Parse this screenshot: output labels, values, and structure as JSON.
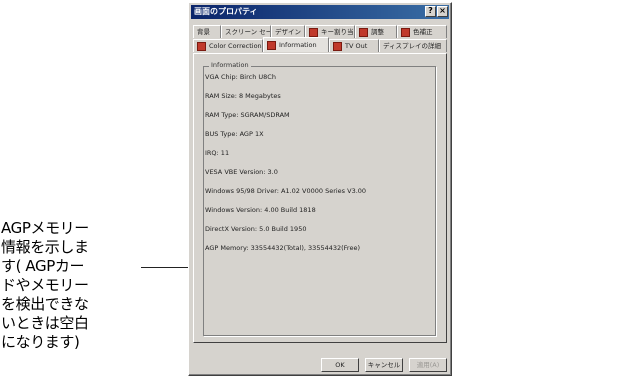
{
  "dialog": {
    "title": "画面のプロパティ",
    "tabs_row1": [
      {
        "label": "背景",
        "icon": false
      },
      {
        "label": "スクリーン セーバー",
        "icon": false
      },
      {
        "label": "デザイン",
        "icon": false
      },
      {
        "label": "キー割り当て",
        "icon": true
      },
      {
        "label": "調整",
        "icon": true
      },
      {
        "label": "色補正",
        "icon": true
      }
    ],
    "tabs_row2": [
      {
        "label": "Color Correction",
        "icon": true
      },
      {
        "label": "Information",
        "icon": true,
        "active": true
      },
      {
        "label": "TV Out",
        "icon": true
      },
      {
        "label": "ディスプレイの詳細",
        "icon": false
      }
    ],
    "group_label": "Information",
    "info": [
      "VGA Chip: Birch U8Ch",
      "RAM Size: 8 Megabytes",
      "RAM Type: SGRAM/SDRAM",
      "BUS Type: AGP 1X",
      "IRQ: 11",
      "VESA VBE Version: 3.0",
      "Windows 95/98 Driver: A1.02 V0000 Series V3.00",
      "Windows Version: 4.00 Build 1818",
      "DirectX Version: 5.0 Build 1950",
      "AGP Memory: 33554432(Total), 33554432(Free)"
    ],
    "buttons": {
      "ok": "OK",
      "cancel": "キャンセル",
      "apply": "適用(A)"
    }
  },
  "callout": {
    "lines": [
      "AGPメモリー",
      "情報を示しま",
      "す( AGPカー",
      "ドやメモリー",
      "を検出できな",
      "いときは空白",
      "になります)"
    ]
  },
  "colors": {
    "highlight_border": "#1f3f8f",
    "titlebar": "#0a246a",
    "tab_icon": "#c0392b"
  }
}
